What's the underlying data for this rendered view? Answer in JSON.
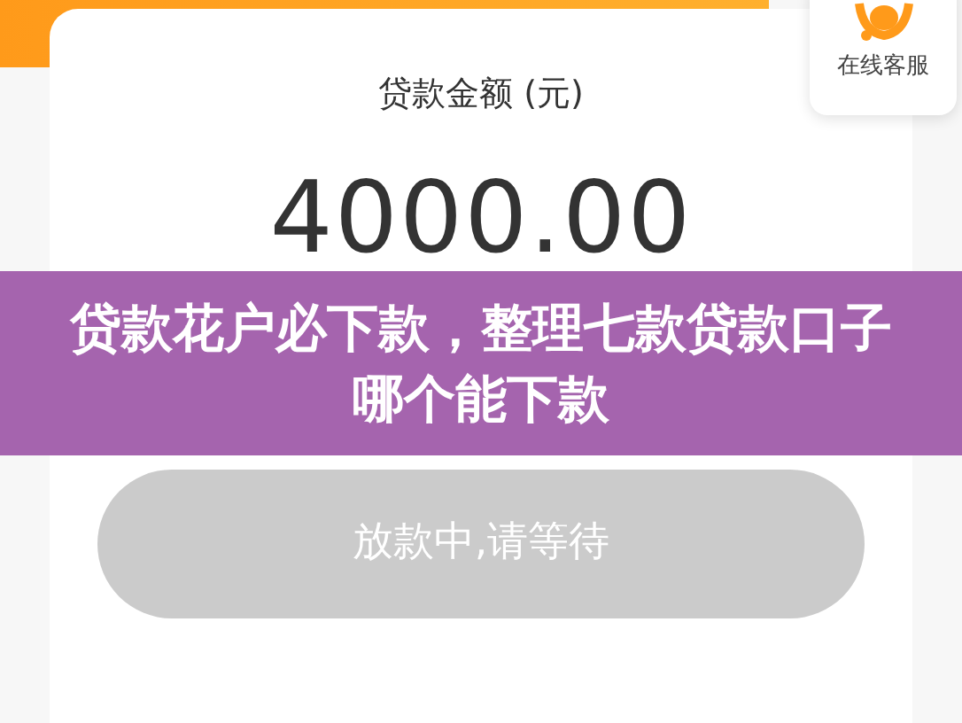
{
  "support": {
    "label": "在线客服"
  },
  "loan": {
    "label": "贷款金额 (元)",
    "amount": "4000.00"
  },
  "banner": {
    "title": "贷款花户必下款，整理七款贷款口子哪个能下款"
  },
  "button": {
    "label": "放款中,请等待",
    "disabled": true
  }
}
